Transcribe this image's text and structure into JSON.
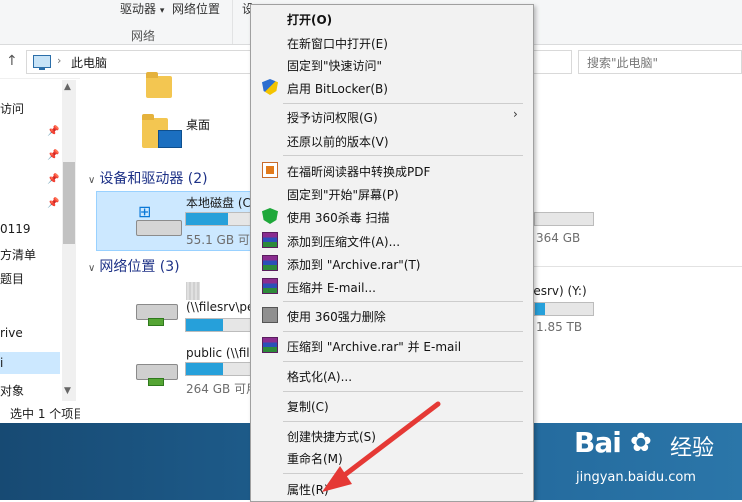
{
  "ribbon": {
    "drives_label": "驱动器",
    "network_location": "网络位置",
    "settings_partial": "设",
    "group_label": "网络"
  },
  "address": {
    "path": "此电脑",
    "search_placeholder": "搜索\"此电脑\""
  },
  "nav": {
    "items": [
      "访问",
      "0119",
      "方清单",
      "题目",
      "rive",
      "i",
      "对象"
    ]
  },
  "status": {
    "text": "选中 1 个项目"
  },
  "content": {
    "desktop_label": "桌面",
    "devices_header": "设备和驱动器 (2)",
    "network_header": "网络位置 (3)",
    "local_disk": {
      "name": "本地磁盘 (C",
      "size": "55.1 GB 可用",
      "fill": 0.62
    },
    "right_disk": {
      "size": "364 GB",
      "fill": 0.0
    },
    "net1": {
      "name": "(\\\\filesrv\\pe",
      "fill": 0.55
    },
    "net2": {
      "name": "public (\\\\file",
      "size": "264 GB 可用",
      "fill": 0.55
    },
    "net_right": {
      "name": "lesrv) (Y:)",
      "size": "1.85 TB",
      "fill": 0.18
    }
  },
  "menu": {
    "items": [
      "打开(O)",
      "在新窗口中打开(E)",
      "固定到\"快速访问\"",
      "启用 BitLocker(B)",
      "授予访问权限(G)",
      "还原以前的版本(V)",
      "在福昕阅读器中转换成PDF",
      "固定到\"开始\"屏幕(P)",
      "使用 360杀毒 扫描",
      "添加到压缩文件(A)...",
      "添加到 \"Archive.rar\"(T)",
      "压缩并 E-mail...",
      "使用 360强力删除",
      "压缩到 \"Archive.rar\" 并 E-mail",
      "格式化(A)...",
      "复制(C)",
      "创建快捷方式(S)",
      "重命名(M)",
      "属性(R)"
    ]
  },
  "watermark": {
    "brand": "Bai",
    "brand2": "经验",
    "url": "jingyan.baidu.com"
  },
  "colors": {
    "accent": "#26a0da",
    "selection": "#cce8ff",
    "annotation": "#e53935"
  }
}
